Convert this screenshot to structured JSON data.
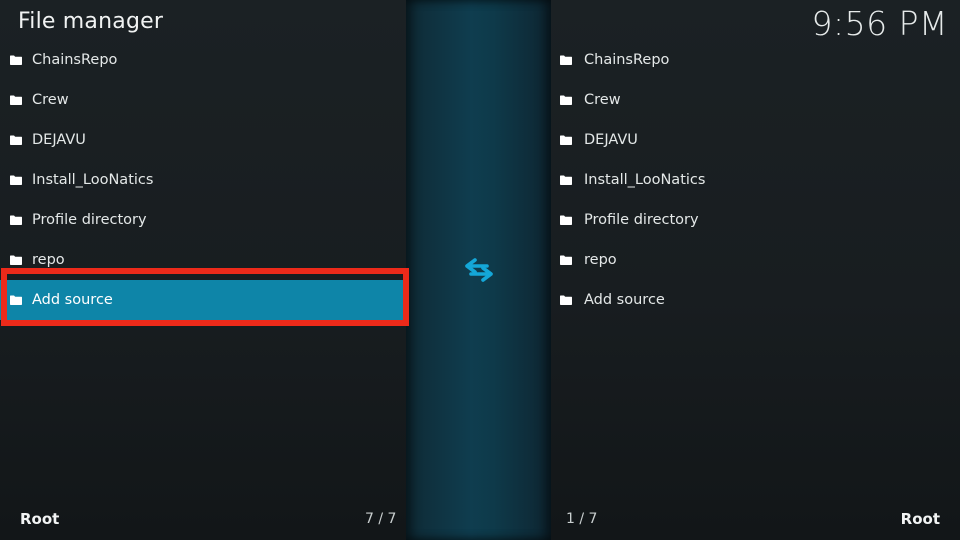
{
  "header": {
    "title": "File manager",
    "clock": "9:56 PM"
  },
  "left_pane": {
    "items": [
      {
        "label": "ChainsRepo"
      },
      {
        "label": "Crew"
      },
      {
        "label": "DEJAVU"
      },
      {
        "label": "Install_LooNatics"
      },
      {
        "label": "Profile directory"
      },
      {
        "label": "repo"
      },
      {
        "label": "Add source"
      }
    ],
    "selected_index": 6,
    "footer_label": "Root",
    "footer_count": "7 / 7"
  },
  "right_pane": {
    "items": [
      {
        "label": "ChainsRepo"
      },
      {
        "label": "Crew"
      },
      {
        "label": "DEJAVU"
      },
      {
        "label": "Install_LooNatics"
      },
      {
        "label": "Profile directory"
      },
      {
        "label": "repo"
      },
      {
        "label": "Add source"
      }
    ],
    "footer_label": "Root",
    "footer_count": "1 / 7"
  },
  "icons": {
    "item_icon": "folder-icon",
    "swap_icon": "swap-arrows-icon"
  },
  "colors": {
    "accent": "#14a7d8",
    "selection": "#0e85a8",
    "annotation": "#ec2a1a"
  }
}
